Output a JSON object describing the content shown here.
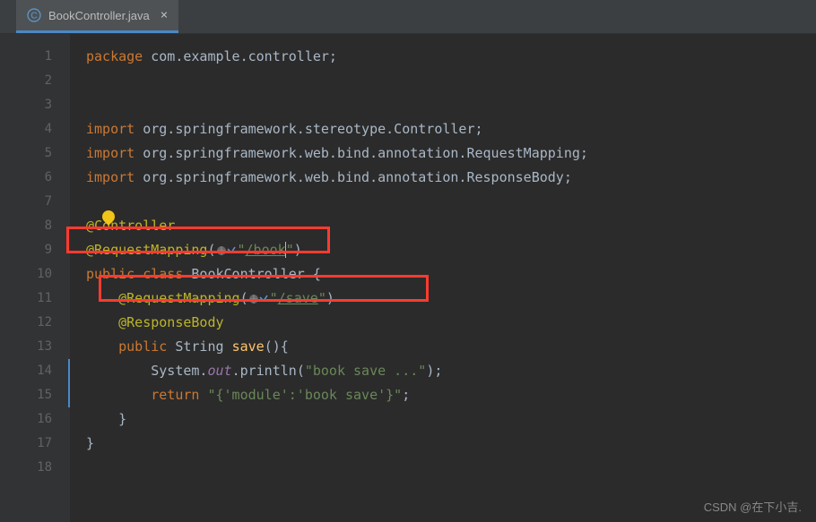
{
  "tab": {
    "label": "BookController.java",
    "close": "×"
  },
  "gutter": {
    "lines": [
      "1",
      "2",
      "3",
      "4",
      "5",
      "6",
      "7",
      "8",
      "9",
      "10",
      "11",
      "12",
      "13",
      "14",
      "15",
      "16",
      "17",
      "18"
    ]
  },
  "code": {
    "l1": {
      "kw": "package",
      "rest": " com.example.controller;"
    },
    "l4": {
      "kw": "import",
      "rest": " org.springframework.stereotype.Controller;"
    },
    "l5": {
      "kw": "import",
      "rest": " org.springframework.web.bind.annotation.RequestMapping;"
    },
    "l6": {
      "kw": "import",
      "rest": " org.springframework.web.bind.annotation.ResponseBody;"
    },
    "l8": {
      "ann": "@Controller"
    },
    "l9": {
      "ann": "@RequestMapping",
      "open": "(",
      "q1": "\"",
      "url": "/book",
      "q2": "\"",
      "close": ")"
    },
    "l10": {
      "mods": "public class ",
      "name": "BookController",
      "brace": " {"
    },
    "l11": {
      "indent": "    ",
      "ann": "@RequestMapping",
      "open": "(",
      "q1": "\"",
      "url": "/save",
      "q2": "\"",
      "close": ")"
    },
    "l12": {
      "indent": "    ",
      "ann": "@ResponseBody"
    },
    "l13": {
      "indent": "    ",
      "mods": "public ",
      "type": "String ",
      "name": "save",
      "sig": "(){"
    },
    "l14": {
      "indent": "        ",
      "cls": "System.",
      "field": "out",
      "dot": ".",
      "mth": "println",
      "open": "(",
      "str": "\"book save ...\"",
      "close": ");"
    },
    "l15": {
      "indent": "        ",
      "kw": "return ",
      "str": "\"{'module':'book save'}\"",
      "semi": ";"
    },
    "l16": {
      "indent": "    ",
      "brace": "}"
    },
    "l17": {
      "brace": "}"
    }
  },
  "watermark": "CSDN @在下小吉."
}
